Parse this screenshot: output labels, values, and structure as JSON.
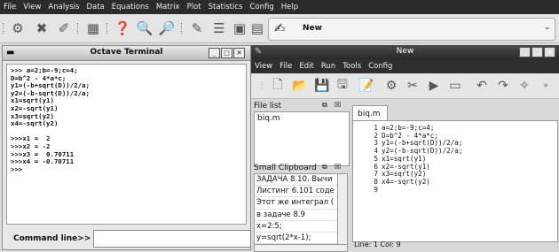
{
  "menubar": {
    "items": [
      "File",
      "View",
      "Analysis",
      "Data",
      "Equations",
      "Matrix",
      "Plot",
      "Statistics",
      "Config",
      "Help"
    ]
  },
  "toolbar": {
    "icons": [
      "gear-icon",
      "tools-icon",
      "eraser-icon",
      "calculator-icon",
      "help-icon",
      "zoom-in-icon",
      "zoom-out-icon",
      "pen-icon",
      "list-icon",
      "image-icon",
      "note-icon"
    ],
    "new_label": "New"
  },
  "terminal": {
    "title": "Octave Terminal",
    "output": ">>> a=2;b=-9;c=4;\nD=b^2 - 4*a*c;\ny1=(-b+sqrt(D))/2/a;\ny2=(-b-sqrt(D))/2/a;\nx1=sqrt(y1)\nx2=-sqrt(y1)\nx3=sqrt(y2)\nx4=-sqrt(y2)\n\n>>>x1 =  2\n>>>x2 = -2\n>>>x3 =  0.70711\n>>>x4 = -0.70711\n>>>",
    "command_label": "Command line>>",
    "command_value": ""
  },
  "editor": {
    "title": "New",
    "menu": [
      "View",
      "File",
      "Edit",
      "Run",
      "Tools",
      "Config"
    ],
    "file_list_label": "File list",
    "files": [
      "biq.m"
    ],
    "clipboard_label": "Small Clipboard",
    "clipboard_items": [
      "ЗАДАЧА 8.10. Вычи",
      "Листинг 6.101 соде",
      "Этот же интеграл (",
      "в задаче 8.9",
      "x=2:5;",
      "y=sqrt(2*x-1);"
    ],
    "tab_label": "biq.m",
    "code_lines": [
      {
        "n": "1",
        "text": "a=2;b=-9;c=4;"
      },
      {
        "n": "2",
        "text": "D=b^2 - 4*a*c;"
      },
      {
        "n": "3",
        "text": "y1=(-b+sqrt(D))/2/a;"
      },
      {
        "n": "4",
        "text": "y2=(-b-sqrt(D))/2/a;"
      },
      {
        "n": "5",
        "text": "x1=sqrt(y1)"
      },
      {
        "n": "6",
        "text": "x2=-sqrt(y1)"
      },
      {
        "n": "7",
        "text": "x3=sqrt(y2)"
      },
      {
        "n": "8",
        "text": "x4=-sqrt(y2)"
      },
      {
        "n": "9",
        "text": ""
      }
    ],
    "status": "Line: 1 Col: 9"
  }
}
